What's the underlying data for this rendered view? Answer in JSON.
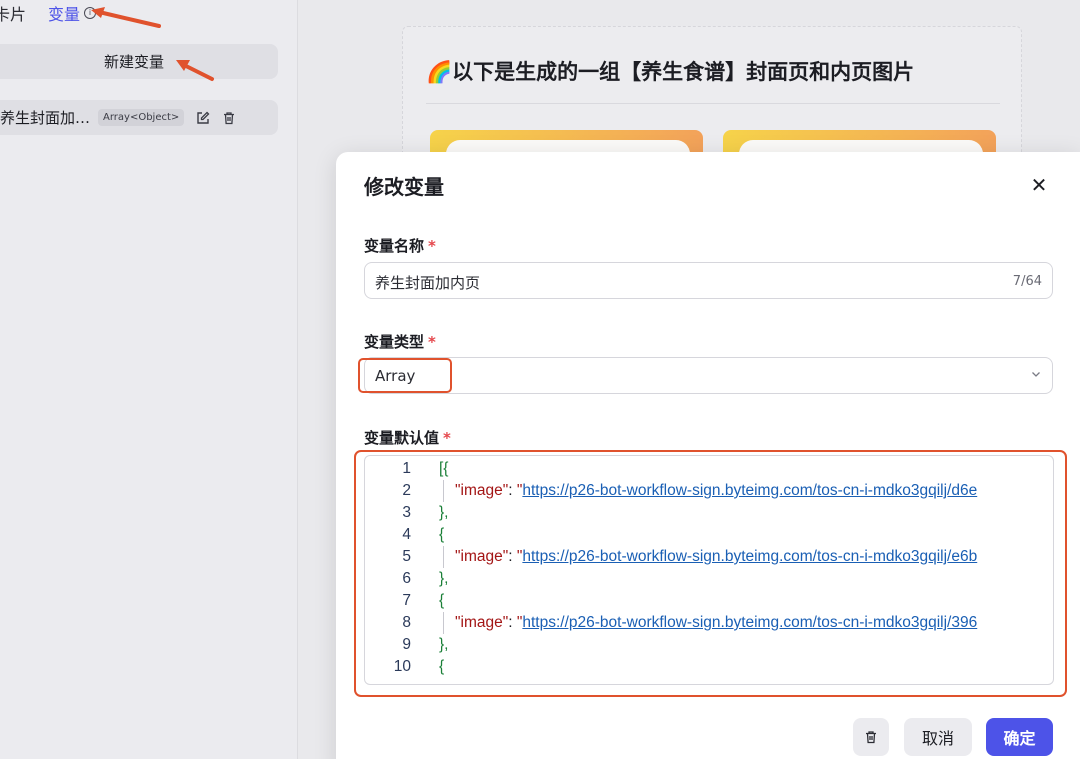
{
  "sidebar": {
    "tabs": [
      {
        "label": "卡片"
      },
      {
        "label": "变量"
      }
    ],
    "new_variable_label": "新建变量",
    "variable_item": {
      "name": "养生封面加…",
      "type": "Array<Object>"
    }
  },
  "preview": {
    "title": "🌈以下是生成的一组【养生食谱】封面页和内页图片"
  },
  "modal": {
    "title": "修改变量",
    "name_field": {
      "label": "变量名称",
      "required_mark": "*",
      "value": "养生封面加内页",
      "counter": "7/64"
    },
    "type_field": {
      "label": "变量类型",
      "required_mark": "*",
      "value": "Array"
    },
    "default_field": {
      "label": "变量默认值",
      "required_mark": "*",
      "lines": [
        {
          "num": "1",
          "kind": "open",
          "text": "[{"
        },
        {
          "num": "2",
          "kind": "entry",
          "key": "\"image\"",
          "colon": ": ",
          "quote": "\"",
          "url": "https://p26-bot-workflow-sign.byteimg.com/tos-cn-i-mdko3gqilj/d6e"
        },
        {
          "num": "3",
          "kind": "close",
          "text": "},"
        },
        {
          "num": "4",
          "kind": "open",
          "text": "{"
        },
        {
          "num": "5",
          "kind": "entry",
          "key": "\"image\"",
          "colon": ": ",
          "quote": "\"",
          "url": "https://p26-bot-workflow-sign.byteimg.com/tos-cn-i-mdko3gqilj/e6b"
        },
        {
          "num": "6",
          "kind": "close",
          "text": "},"
        },
        {
          "num": "7",
          "kind": "open",
          "text": "{"
        },
        {
          "num": "8",
          "kind": "entry",
          "key": "\"image\"",
          "colon": ": ",
          "quote": "\"",
          "url": "https://p26-bot-workflow-sign.byteimg.com/tos-cn-i-mdko3gqilj/396"
        },
        {
          "num": "9",
          "kind": "close",
          "text": "},"
        },
        {
          "num": "10",
          "kind": "open",
          "text": "{"
        }
      ]
    },
    "buttons": {
      "cancel": "取消",
      "confirm": "确定"
    }
  },
  "colors": {
    "accent": "#4d53e8",
    "highlight": "#e0522d"
  }
}
